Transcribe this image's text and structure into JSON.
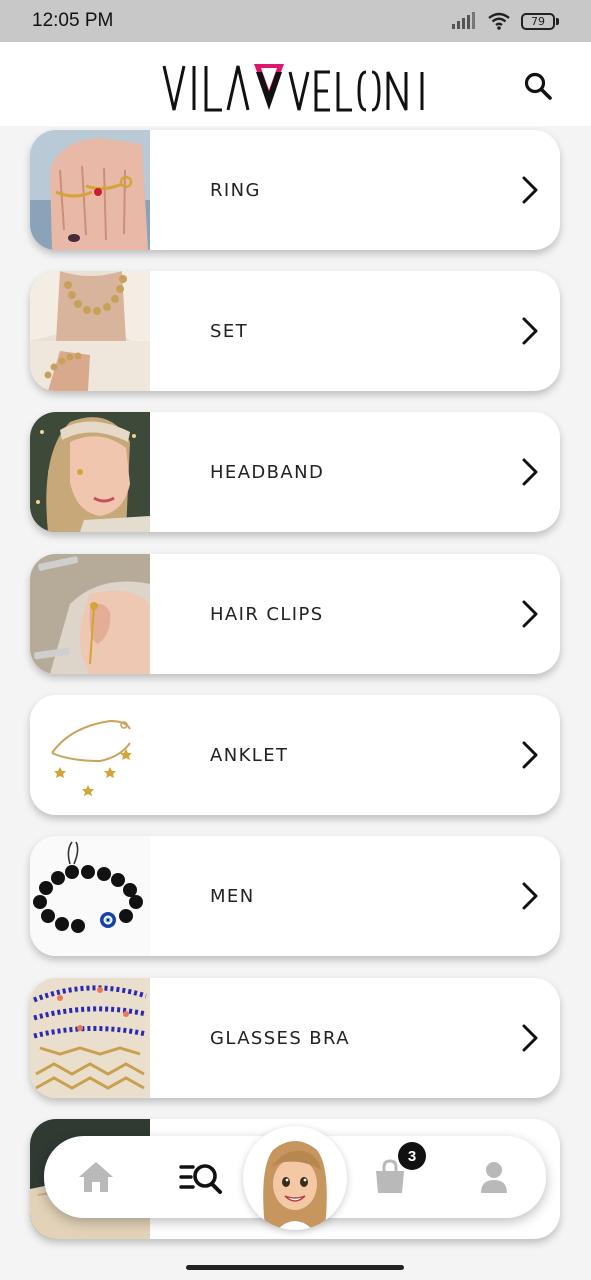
{
  "status_bar": {
    "time": "12:05 PM",
    "battery_level": "79",
    "icons": [
      "signal-icon",
      "wifi-icon",
      "battery-icon"
    ]
  },
  "header": {
    "logo_text_left": "VILA",
    "logo_text_right": "VELONI",
    "logo_mark": "pink-triangle-v",
    "search_icon": "search-icon"
  },
  "categories": [
    {
      "label": "RING",
      "thumb": "hand-with-gold-rings"
    },
    {
      "label": "SET",
      "thumb": "gold-bead-necklace-and-bracelet"
    },
    {
      "label": "HEADBAND",
      "thumb": "woman-wearing-headband"
    },
    {
      "label": "HAIR CLIPS",
      "thumb": "hair-clips-and-ear-cuff"
    },
    {
      "label": "ANKLET",
      "thumb": "gold-star-anklet"
    },
    {
      "label": "MEN",
      "thumb": "black-bead-evil-eye-bracelet"
    },
    {
      "label": "GLASSES BRA",
      "thumb": "beaded-glasses-chains"
    },
    {
      "label": "",
      "thumb": "pouch-partial"
    }
  ],
  "bottom_nav": {
    "items": [
      "home-icon",
      "menu-search-icon",
      "avatar",
      "shopping-bag-icon",
      "user-icon"
    ],
    "cart_count": "3"
  },
  "colors": {
    "brand_pink": "#e0156e",
    "background": "#f4f4f4",
    "status_bar": "#c8c8c8",
    "inactive_icon": "#b9b9b9"
  }
}
